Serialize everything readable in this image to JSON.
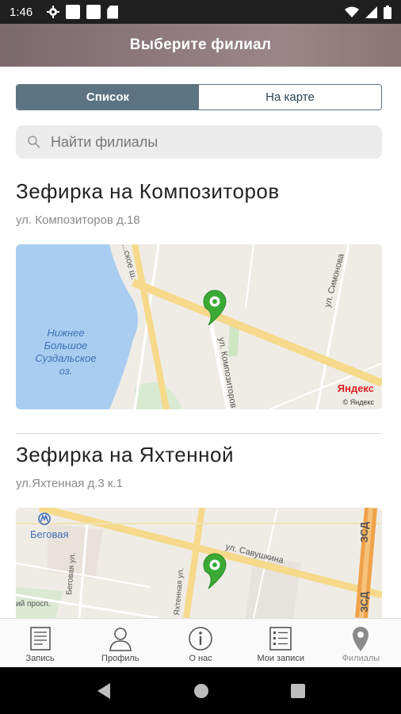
{
  "status_bar": {
    "time": "1:46"
  },
  "header": {
    "title": "Выберите филиал"
  },
  "segmented": {
    "list_label": "Список",
    "map_label": "На карте",
    "selected": "list"
  },
  "search": {
    "placeholder": "Найти филиалы"
  },
  "branches": [
    {
      "name": "Зефирка на Композиторов",
      "address": "ул. Композиторов д.18",
      "map_labels": {
        "lake": [
          "Нижнее",
          "Большое",
          "Суздальское",
          "оз."
        ],
        "street_1": "ул. Композиторов",
        "street_2": "ул. Симонова",
        "street_3": "...ское ш.",
        "brand": "Яндекс",
        "copyright": "© Яндекс"
      }
    },
    {
      "name": "Зефирка на Яхтенной",
      "address": "ул.Яхтенная д.3 к.1",
      "map_labels": {
        "metro": "Беговая",
        "street_1": "ул. Савушкина",
        "street_2": "Беговая ул.",
        "street_3": "Яхтенная ул.",
        "street_4": "ий просп.",
        "road": "ЗСД"
      }
    }
  ],
  "bottom_nav": [
    {
      "label": "Запись",
      "icon": "document-icon"
    },
    {
      "label": "Профиль",
      "icon": "person-icon"
    },
    {
      "label": "О нас",
      "icon": "info-icon"
    },
    {
      "label": "Мои записи",
      "icon": "list-icon"
    },
    {
      "label": "Филиалы",
      "icon": "location-pin-icon",
      "active": true
    }
  ],
  "colors": {
    "accent": "#5c7382",
    "pin": "#3aaa35",
    "road": "#f6d98a",
    "water": "#a8cdf0"
  }
}
